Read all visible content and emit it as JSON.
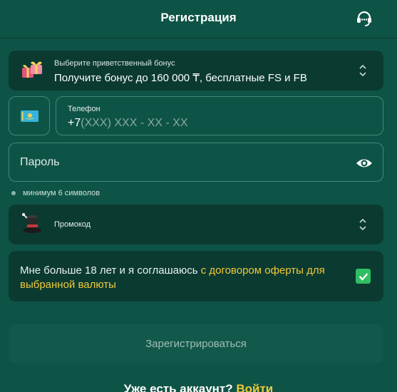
{
  "header": {
    "title": "Регистрация",
    "support_icon": "headset-icon"
  },
  "bonus": {
    "label": "Выберите приветственный бонус",
    "value": "Получите бонус до 160 000 ₸, бесплатные FS и FB",
    "icon": "gift-icon"
  },
  "phone": {
    "country_flag": "kazakhstan-flag-icon",
    "label": "Телефон",
    "code": "+7",
    "mask": "(XXX) XXX - XX - XX"
  },
  "password": {
    "placeholder": "Пароль",
    "hint": "минимум 6 символов",
    "toggle_icon": "eye-icon"
  },
  "promo": {
    "label": "Промокод",
    "icon": "magic-hat-icon"
  },
  "agreement": {
    "text": "Мне больше 18 лет и я соглашаюсь ",
    "link": "с договором оферты для выбранной валюты",
    "checked": true
  },
  "submit": {
    "label": "Зарегистрироваться"
  },
  "login": {
    "prompt": "Уже есть аккаунт? ",
    "link": "Войти"
  },
  "colors": {
    "background": "#0e5446",
    "field": "#0b3a31",
    "accent": "#f0c93a",
    "checkbox": "#2fbe63"
  }
}
